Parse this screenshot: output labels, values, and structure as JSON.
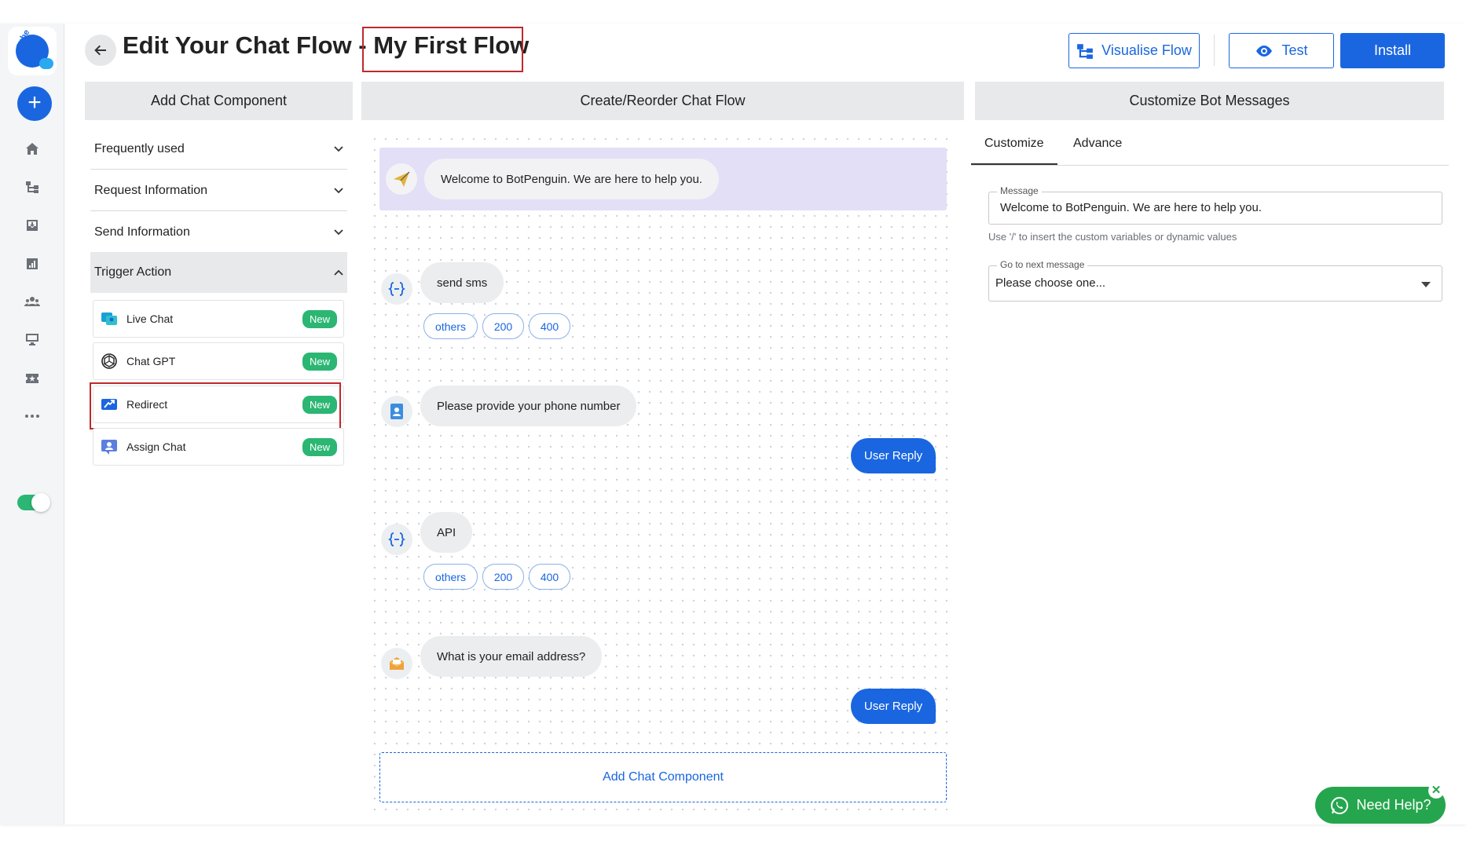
{
  "header": {
    "title_prefix": "Edit Your Chat Flow -",
    "flow_name": "My First Flow",
    "visualise_label": "Visualise Flow",
    "test_label": "Test",
    "install_label": "Install"
  },
  "sections": {
    "left": "Add Chat Component",
    "center": "Create/Reorder Chat Flow",
    "right": "Customize Bot Messages"
  },
  "left_panel": {
    "accordion": [
      {
        "label": "Frequently used"
      },
      {
        "label": "Request Information"
      },
      {
        "label": "Send Information"
      },
      {
        "label": "Trigger Action"
      }
    ],
    "components": [
      {
        "label": "Live Chat",
        "badge": "New"
      },
      {
        "label": "Chat GPT",
        "badge": "New"
      },
      {
        "label": "Redirect",
        "badge": "New"
      },
      {
        "label": "Assign Chat",
        "badge": "New"
      }
    ]
  },
  "flow": {
    "welcome": "Welcome to BotPenguin. We are here to help you.",
    "nodes": [
      {
        "text": "send sms",
        "chips": [
          "others",
          "200",
          "400"
        ]
      },
      {
        "text": "Please provide your phone number"
      },
      {
        "text": "API",
        "chips": [
          "others",
          "200",
          "400"
        ]
      },
      {
        "text": "What is your email address?"
      }
    ],
    "user_reply": "User Reply",
    "add_component": "Add Chat Component"
  },
  "right_panel": {
    "tabs": [
      "Customize",
      "Advance"
    ],
    "message_label": "Message",
    "message_value": "Welcome to BotPenguin. We are here to help you.",
    "hint": "Use '/' to insert the custom variables or dynamic values",
    "next_label": "Go to next message",
    "next_value": "Please choose one..."
  },
  "help": {
    "label": "Need Help?",
    "close": "✕"
  },
  "brand": {
    "logo_text": "cube",
    "accent": "#1a66e0",
    "success": "#2bb673",
    "highlight_border": "#c0282d"
  }
}
